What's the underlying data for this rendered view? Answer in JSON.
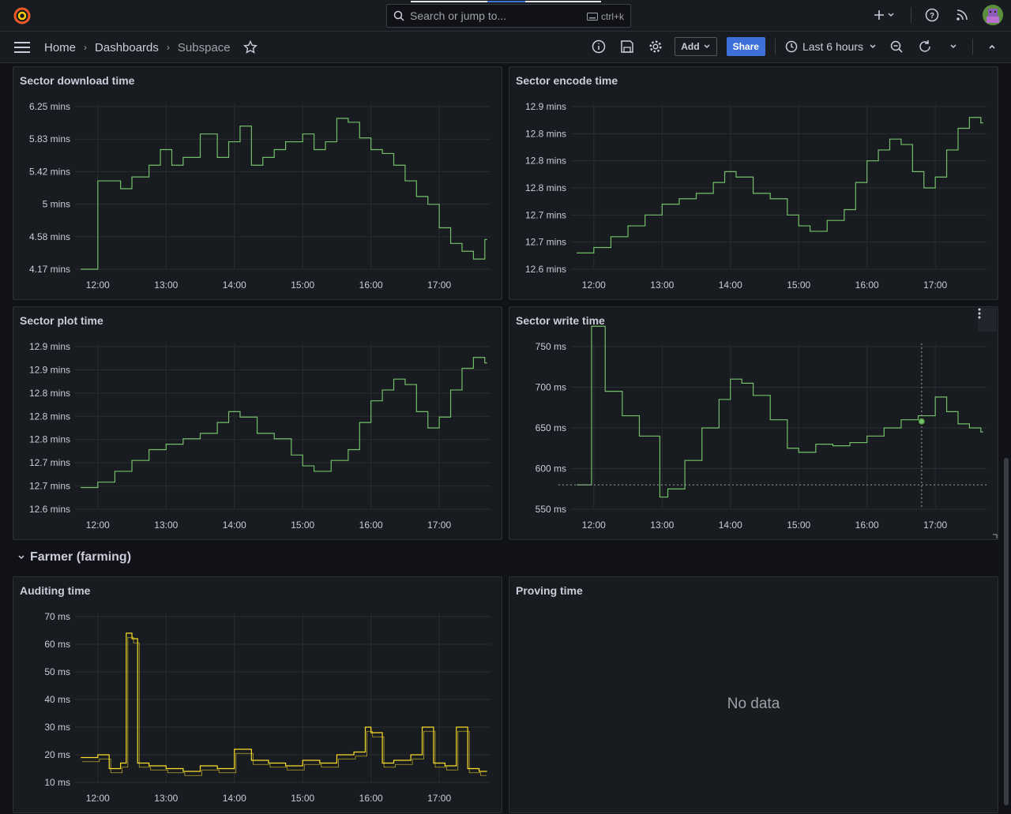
{
  "search": {
    "placeholder": "Search or jump to...",
    "shortcut": "ctrl+k"
  },
  "breadcrumb": {
    "home": "Home",
    "dashboards": "Dashboards",
    "current": "Subspace"
  },
  "toolbar": {
    "add_label": "Add",
    "share_label": "Share",
    "time_range": "Last 6 hours"
  },
  "row": {
    "title": "Farmer (farming)"
  },
  "panels": {
    "download": {
      "title": "Sector download time"
    },
    "encode": {
      "title": "Sector encode time"
    },
    "plot": {
      "title": "Sector plot time"
    },
    "write": {
      "title": "Sector write time"
    },
    "auditing": {
      "title": "Auditing time"
    },
    "proving": {
      "title": "Proving time",
      "nodata": "No data"
    }
  },
  "colors": {
    "series_green": "#73bf69",
    "series_yellow": "#fade2a",
    "accent": "#3d71d9"
  },
  "chart_data": [
    {
      "id": "download",
      "type": "line",
      "title": "Sector download time",
      "xticks": [
        "12:00",
        "13:00",
        "14:00",
        "15:00",
        "16:00",
        "17:00"
      ],
      "yticks": [
        "6.25 mins",
        "5.83 mins",
        "5.42 mins",
        "5 mins",
        "4.58 mins",
        "4.17 mins"
      ],
      "ylim": [
        4.17,
        6.25
      ],
      "x": [
        "11:45",
        "11:55",
        "12:00",
        "12:20",
        "12:30",
        "12:45",
        "12:55",
        "13:05",
        "13:15",
        "13:30",
        "13:45",
        "13:55",
        "14:05",
        "14:15",
        "14:25",
        "14:35",
        "14:45",
        "15:00",
        "15:10",
        "15:20",
        "15:30",
        "15:40",
        "15:50",
        "16:00",
        "16:10",
        "16:20",
        "16:30",
        "16:40",
        "16:50",
        "17:00",
        "17:10",
        "17:20",
        "17:30",
        "17:40"
      ],
      "values": [
        4.17,
        4.17,
        5.3,
        5.2,
        5.35,
        5.5,
        5.7,
        5.5,
        5.6,
        5.9,
        5.6,
        5.8,
        6.0,
        5.5,
        5.6,
        5.7,
        5.8,
        5.9,
        5.7,
        5.8,
        6.1,
        6.05,
        5.85,
        5.7,
        5.65,
        5.5,
        5.3,
        5.1,
        5.0,
        4.7,
        4.5,
        4.4,
        4.3,
        4.55
      ],
      "series": [
        {
          "name": "",
          "color": "#73bf69"
        }
      ]
    },
    {
      "id": "encode",
      "type": "line",
      "title": "Sector encode time",
      "xticks": [
        "12:00",
        "13:00",
        "14:00",
        "15:00",
        "16:00",
        "17:00"
      ],
      "yticks": [
        "12.9 mins",
        "12.8 mins",
        "12.8 mins",
        "12.8 mins",
        "12.7 mins",
        "12.7 mins",
        "12.6 mins"
      ],
      "ylim": [
        12.6,
        12.9
      ],
      "x": [
        "11:45",
        "12:00",
        "12:15",
        "12:30",
        "12:45",
        "13:00",
        "13:15",
        "13:30",
        "13:45",
        "13:55",
        "14:05",
        "14:20",
        "14:35",
        "14:50",
        "15:00",
        "15:10",
        "15:25",
        "15:40",
        "15:50",
        "16:00",
        "16:10",
        "16:20",
        "16:30",
        "16:40",
        "16:50",
        "17:00",
        "17:10",
        "17:20",
        "17:30",
        "17:40"
      ],
      "values": [
        12.63,
        12.64,
        12.66,
        12.68,
        12.7,
        12.72,
        12.73,
        12.74,
        12.76,
        12.78,
        12.77,
        12.74,
        12.73,
        12.7,
        12.68,
        12.67,
        12.69,
        12.71,
        12.76,
        12.8,
        12.82,
        12.84,
        12.83,
        12.78,
        12.75,
        12.77,
        12.82,
        12.86,
        12.88,
        12.87
      ],
      "series": [
        {
          "name": "",
          "color": "#73bf69"
        }
      ]
    },
    {
      "id": "plot",
      "type": "line",
      "title": "Sector plot time",
      "xticks": [
        "12:00",
        "13:00",
        "14:00",
        "15:00",
        "16:00",
        "17:00"
      ],
      "yticks": [
        "12.9 mins",
        "12.9 mins",
        "12.8 mins",
        "12.8 mins",
        "12.8 mins",
        "12.7 mins",
        "12.7 mins",
        "12.6 mins"
      ],
      "ylim": [
        12.6,
        12.9
      ],
      "x": [
        "11:45",
        "12:00",
        "12:15",
        "12:30",
        "12:45",
        "13:00",
        "13:15",
        "13:30",
        "13:45",
        "13:55",
        "14:05",
        "14:20",
        "14:35",
        "14:50",
        "15:00",
        "15:10",
        "15:25",
        "15:40",
        "15:50",
        "16:00",
        "16:10",
        "16:20",
        "16:30",
        "16:40",
        "16:50",
        "17:00",
        "17:10",
        "17:20",
        "17:30",
        "17:40"
      ],
      "values": [
        12.64,
        12.65,
        12.67,
        12.69,
        12.71,
        12.72,
        12.73,
        12.74,
        12.76,
        12.78,
        12.77,
        12.74,
        12.73,
        12.7,
        12.68,
        12.67,
        12.69,
        12.71,
        12.76,
        12.8,
        12.82,
        12.84,
        12.83,
        12.78,
        12.75,
        12.77,
        12.82,
        12.86,
        12.88,
        12.87
      ],
      "series": [
        {
          "name": "",
          "color": "#73bf69"
        }
      ]
    },
    {
      "id": "write",
      "type": "line",
      "title": "Sector write time",
      "xticks": [
        "12:00",
        "13:00",
        "14:00",
        "15:00",
        "16:00",
        "17:00"
      ],
      "yticks": [
        "750 ms",
        "700 ms",
        "650 ms",
        "600 ms",
        "550 ms"
      ],
      "ylim": [
        550,
        750
      ],
      "x": [
        "11:45",
        "11:58",
        "12:10",
        "12:25",
        "12:40",
        "12:58",
        "13:05",
        "13:20",
        "13:35",
        "13:50",
        "14:00",
        "14:10",
        "14:20",
        "14:35",
        "14:50",
        "15:00",
        "15:15",
        "15:30",
        "15:45",
        "16:00",
        "16:15",
        "16:30",
        "16:45",
        "17:00",
        "17:10",
        "17:20",
        "17:30",
        "17:40"
      ],
      "values": [
        580,
        775,
        695,
        665,
        640,
        565,
        575,
        610,
        650,
        685,
        710,
        705,
        690,
        660,
        625,
        620,
        630,
        628,
        632,
        640,
        650,
        660,
        665,
        688,
        670,
        655,
        650,
        645
      ],
      "series": [
        {
          "name": "",
          "color": "#73bf69"
        }
      ]
    },
    {
      "id": "auditing",
      "type": "line",
      "title": "Auditing time",
      "xticks": [
        "12:00",
        "13:00",
        "14:00",
        "15:00",
        "16:00",
        "17:00"
      ],
      "yticks": [
        "70 ms",
        "60 ms",
        "50 ms",
        "40 ms",
        "30 ms",
        "20 ms",
        "10 ms"
      ],
      "ylim": [
        10,
        70
      ],
      "x": [
        "11:45",
        "12:00",
        "12:10",
        "12:20",
        "12:25",
        "12:30",
        "12:35",
        "12:45",
        "13:00",
        "13:15",
        "13:30",
        "13:45",
        "14:00",
        "14:15",
        "14:30",
        "14:45",
        "15:00",
        "15:15",
        "15:30",
        "15:45",
        "15:55",
        "16:00",
        "16:10",
        "16:20",
        "16:35",
        "16:45",
        "16:55",
        "17:05",
        "17:15",
        "17:25",
        "17:35",
        "17:40"
      ],
      "values": [
        19,
        20,
        15,
        17,
        64,
        62,
        17,
        16,
        15,
        14,
        16,
        15,
        22,
        18,
        17,
        16,
        18,
        17,
        20,
        21,
        30,
        28,
        17,
        18,
        20,
        30,
        17,
        16,
        30,
        15,
        14,
        14
      ],
      "series": [
        {
          "name": "",
          "color": "#fade2a"
        }
      ]
    }
  ]
}
